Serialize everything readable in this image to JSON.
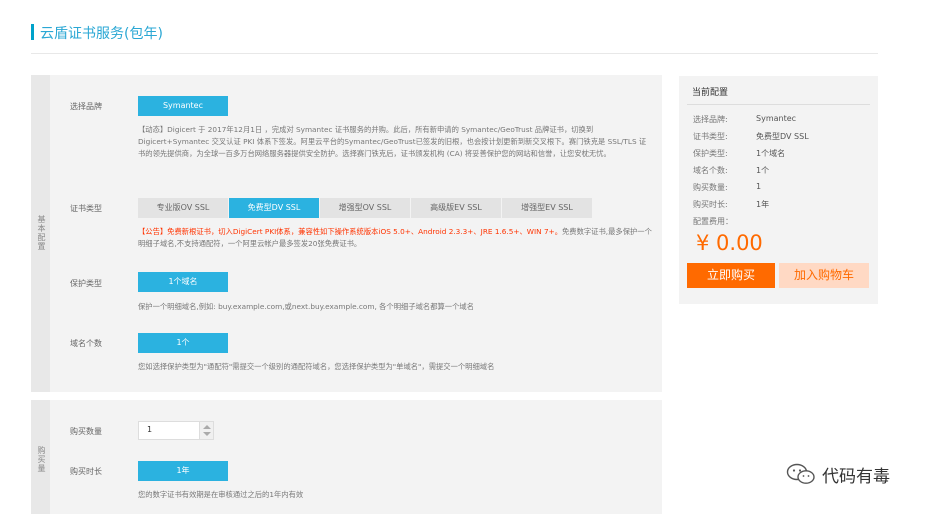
{
  "page": {
    "title": "云盾证书服务(包年)"
  },
  "config_section": {
    "side_label": "基本配置",
    "brand": {
      "label": "选择品牌",
      "selected": "Symantec",
      "description": "【动态】Digicert 于 2017年12月1日 ，完成对 Symantec 证书服务的并购。此后，所有新申请的 Symantec/GeoTrust 品牌证书，切换到 Digicert+Symantec 交叉认证 PKI 体系下签发。阿里云平台的Symantec/GeoTrust已签发的旧根，也会按计划更新到新交叉根下。赛门铁克是 SSL/TLS 证书的领先提供商，为全球一百多万台网络服务器提供安全防护。选择赛门铁克后，证书颁发机构 (CA) 将妥善保护您的网站和信誉，让您安枕无忧。"
    },
    "cert_type": {
      "label": "证书类型",
      "tabs": [
        "专业版OV SSL",
        "免费型DV SSL",
        "增强型OV SSL",
        "高级版EV SSL",
        "增强型EV SSL"
      ],
      "active_index": 1,
      "notice_red": "【公告】免费新根证书，切入DigiCert PKI体系，兼容性如下操作系统版本iOS 5.0+、Android 2.3.3+、JRE 1.6.5+、WIN 7+。",
      "notice_gray": "免费数字证书,最多保护一个明细子域名,不支持通配符，一个阿里云帐户最多签发20张免费证书。"
    },
    "protection": {
      "label": "保护类型",
      "selected": "1个域名",
      "description": "保护一个明细域名,例如: buy.example.com,或next.buy.example.com, 各个明细子域名都算一个域名"
    },
    "domain_count": {
      "label": "域名个数",
      "selected": "1个",
      "description": "您如选择保护类型为\"通配符\"需提交一个级别的通配符域名，您选择保护类型为\"单域名\"，需提交一个明细域名"
    }
  },
  "purchase_section": {
    "side_label": "购买量",
    "quantity": {
      "label": "购买数量",
      "value": "1"
    },
    "duration": {
      "label": "购买时长",
      "selected": "1年",
      "description": "您的数字证书有效期是在审核通过之后的1年内有效"
    }
  },
  "summary": {
    "title": "当前配置",
    "rows": [
      {
        "key": "选择品牌:",
        "value": "Symantec"
      },
      {
        "key": "证书类型:",
        "value": "免费型DV SSL"
      },
      {
        "key": "保护类型:",
        "value": "1个域名"
      },
      {
        "key": "域名个数:",
        "value": "1个"
      },
      {
        "key": "购买数量:",
        "value": "1"
      },
      {
        "key": "购买时长:",
        "value": "1年"
      }
    ],
    "fee_label": "配置费用：",
    "price": "¥ 0.00",
    "buy_label": "立即购买",
    "cart_label": "加入购物车"
  },
  "watermark": {
    "text": "代码有毒"
  },
  "colors": {
    "accent_blue": "#2bb2e0",
    "title_blue": "#2aa7d4",
    "orange": "#ff6a00",
    "orange_light": "#ffd9c4",
    "notice_red": "#ff3300"
  }
}
